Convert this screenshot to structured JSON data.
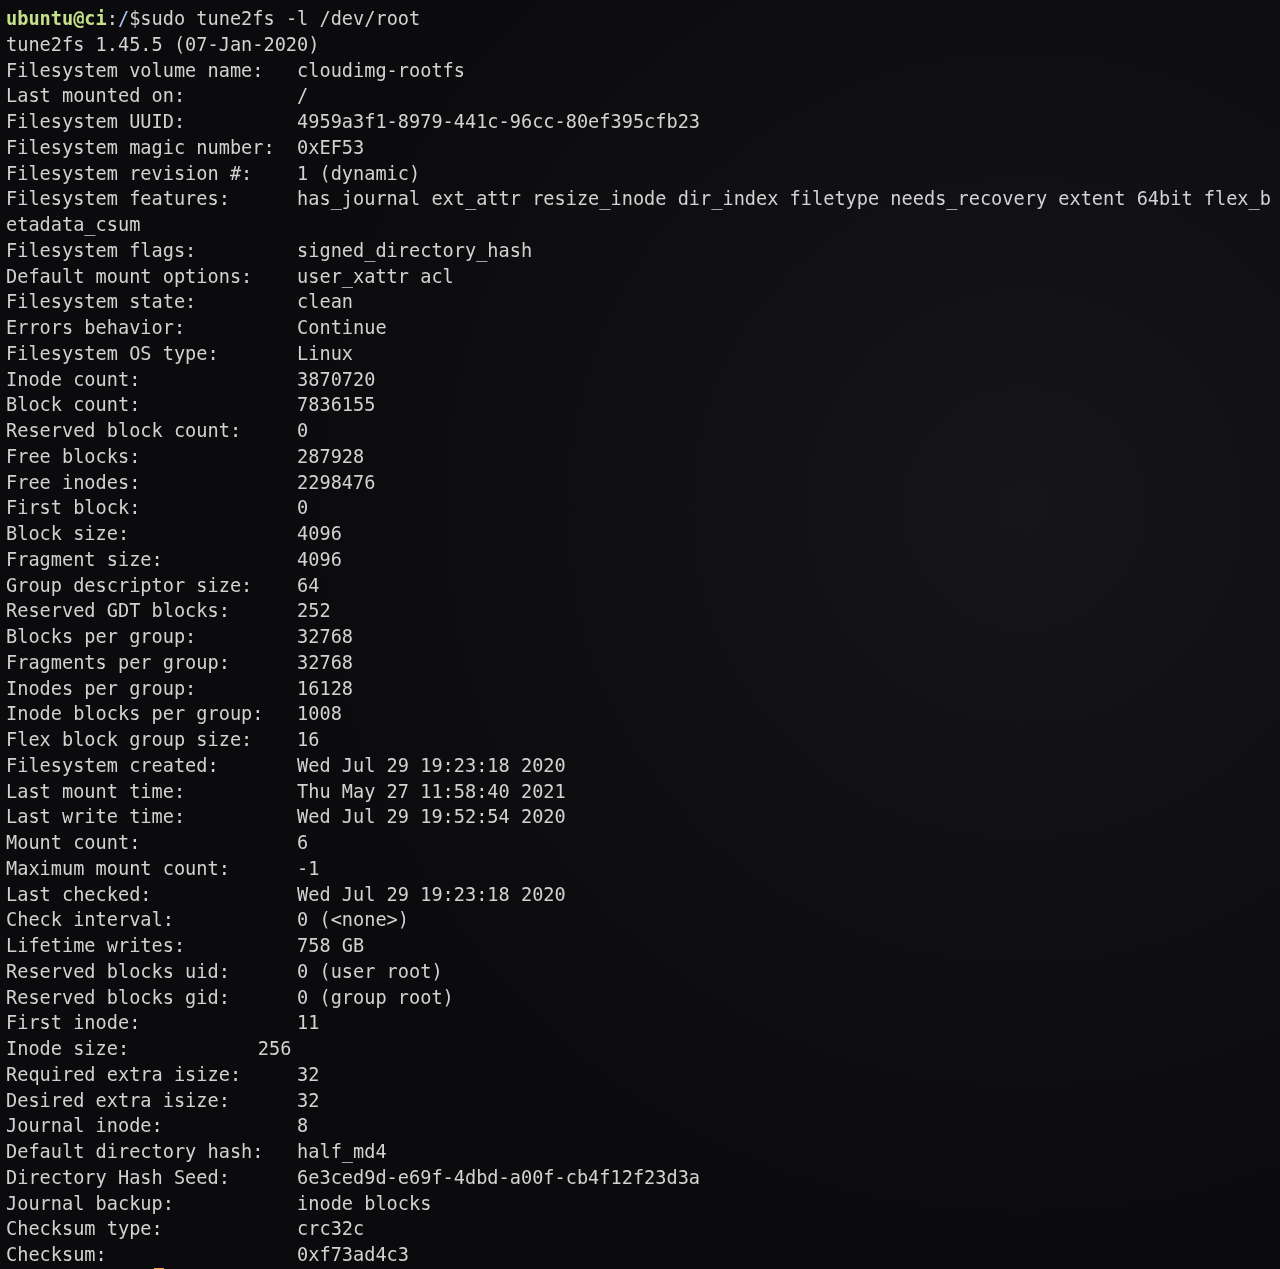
{
  "prompt": {
    "user_host": "ubuntu@ci",
    "separator": ":",
    "path": "/",
    "symbol": "$",
    "command": "sudo tune2fs -l /dev/root"
  },
  "lines": [
    {
      "kind": "text",
      "text": "tune2fs 1.45.5 (07-Jan-2020)"
    },
    {
      "kind": "field",
      "label": "Filesystem volume name:",
      "value": "cloudimg-rootfs"
    },
    {
      "kind": "field",
      "label": "Last mounted on:",
      "value": "/"
    },
    {
      "kind": "field",
      "label": "Filesystem UUID:",
      "value": "4959a3f1-8979-441c-96cc-80ef395cfb23"
    },
    {
      "kind": "field",
      "label": "Filesystem magic number:",
      "value": "0xEF53"
    },
    {
      "kind": "field",
      "label": "Filesystem revision #:",
      "value": "1 (dynamic)"
    },
    {
      "kind": "field",
      "label": "Filesystem features:",
      "value": "has_journal ext_attr resize_inode dir_index filetype needs_recovery extent 64bit flex_b"
    },
    {
      "kind": "text",
      "text": "etadata_csum"
    },
    {
      "kind": "field",
      "label": "Filesystem flags:",
      "value": "signed_directory_hash"
    },
    {
      "kind": "field",
      "label": "Default mount options:",
      "value": "user_xattr acl"
    },
    {
      "kind": "field",
      "label": "Filesystem state:",
      "value": "clean"
    },
    {
      "kind": "field",
      "label": "Errors behavior:",
      "value": "Continue"
    },
    {
      "kind": "field",
      "label": "Filesystem OS type:",
      "value": "Linux"
    },
    {
      "kind": "field",
      "label": "Inode count:",
      "value": "3870720"
    },
    {
      "kind": "field",
      "label": "Block count:",
      "value": "7836155"
    },
    {
      "kind": "field",
      "label": "Reserved block count:",
      "value": "0"
    },
    {
      "kind": "field",
      "label": "Free blocks:",
      "value": "287928"
    },
    {
      "kind": "field",
      "label": "Free inodes:",
      "value": "2298476"
    },
    {
      "kind": "field",
      "label": "First block:",
      "value": "0"
    },
    {
      "kind": "field",
      "label": "Block size:",
      "value": "4096"
    },
    {
      "kind": "field",
      "label": "Fragment size:",
      "value": "4096"
    },
    {
      "kind": "field",
      "label": "Group descriptor size:",
      "value": "64"
    },
    {
      "kind": "field",
      "label": "Reserved GDT blocks:",
      "value": "252"
    },
    {
      "kind": "field",
      "label": "Blocks per group:",
      "value": "32768"
    },
    {
      "kind": "field",
      "label": "Fragments per group:",
      "value": "32768"
    },
    {
      "kind": "field",
      "label": "Inodes per group:",
      "value": "16128"
    },
    {
      "kind": "field",
      "label": "Inode blocks per group:",
      "value": "1008"
    },
    {
      "kind": "field",
      "label": "Flex block group size:",
      "value": "16"
    },
    {
      "kind": "field",
      "label": "Filesystem created:",
      "value": "Wed Jul 29 19:23:18 2020"
    },
    {
      "kind": "field",
      "label": "Last mount time:",
      "value": "Thu May 27 11:58:40 2021"
    },
    {
      "kind": "field",
      "label": "Last write time:",
      "value": "Wed Jul 29 19:52:54 2020"
    },
    {
      "kind": "field",
      "label": "Mount count:",
      "value": "6"
    },
    {
      "kind": "field",
      "label": "Maximum mount count:",
      "value": "-1"
    },
    {
      "kind": "field",
      "label": "Last checked:",
      "value": "Wed Jul 29 19:23:18 2020"
    },
    {
      "kind": "field",
      "label": "Check interval:",
      "value": "0 (<none>)"
    },
    {
      "kind": "field",
      "label": "Lifetime writes:",
      "value": "758 GB"
    },
    {
      "kind": "field",
      "label": "Reserved blocks uid:",
      "value": "0 (user root)"
    },
    {
      "kind": "field",
      "label": "Reserved blocks gid:",
      "value": "0 (group root)"
    },
    {
      "kind": "field",
      "label": "First inode:",
      "value": "11"
    },
    {
      "kind": "tabbed",
      "label": "Inode size:",
      "value": "256"
    },
    {
      "kind": "field",
      "label": "Required extra isize:",
      "value": "32"
    },
    {
      "kind": "field",
      "label": "Desired extra isize:",
      "value": "32"
    },
    {
      "kind": "field",
      "label": "Journal inode:",
      "value": "8"
    },
    {
      "kind": "field",
      "label": "Default directory hash:",
      "value": "half_md4"
    },
    {
      "kind": "field",
      "label": "Directory Hash Seed:",
      "value": "6e3ced9d-e69f-4dbd-a00f-cb4f12f23d3a"
    },
    {
      "kind": "field",
      "label": "Journal backup:",
      "value": "inode blocks"
    },
    {
      "kind": "field",
      "label": "Checksum type:",
      "value": "crc32c"
    },
    {
      "kind": "field",
      "label": "Checksum:",
      "value": "0xf73ad4c3"
    }
  ]
}
